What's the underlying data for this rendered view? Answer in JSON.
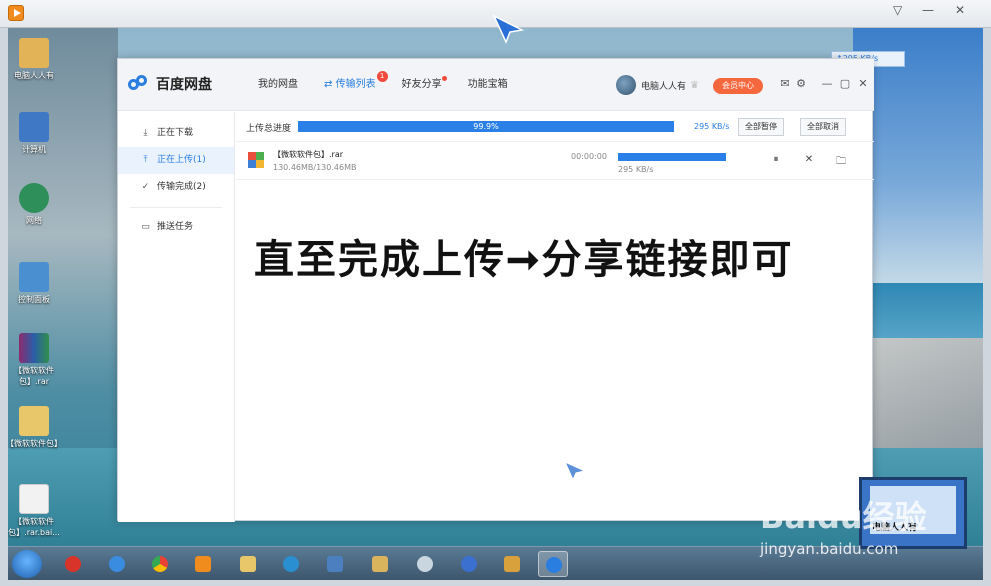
{
  "desktop": {
    "icons": [
      {
        "label": "电脑人人有"
      },
      {
        "label": "计算机"
      },
      {
        "label": "网络"
      },
      {
        "label": "控制面板"
      },
      {
        "label": "【微软软件包】.rar"
      },
      {
        "label": "【微软软件包】"
      },
      {
        "label": "【微软软件包】.rar.bai..."
      }
    ]
  },
  "float_speed": "↑295 KB/s",
  "app": {
    "title": "百度网盘",
    "nav": [
      {
        "label": "我的网盘"
      },
      {
        "label": "传输列表",
        "badge": "1"
      },
      {
        "label": "好友分享"
      },
      {
        "label": "功能宝箱"
      }
    ],
    "user": {
      "name": "电脑人人有",
      "vip_label": "会员中心"
    },
    "sidebar": [
      {
        "label": "正在下载"
      },
      {
        "label": "正在上传(1)"
      },
      {
        "label": "传输完成(2)"
      },
      {
        "label": "推送任务"
      }
    ],
    "upload": {
      "progress_label": "上传总进度",
      "total_percent": "99.9%",
      "speed": "295 KB/s",
      "pause_all": "全部暂停",
      "cancel_all": "全部取消",
      "file": {
        "name": "【微软软件包】.rar",
        "size": "130.46MB/130.46MB",
        "time": "00:00:00",
        "speed": "295 KB/s",
        "progress": 0.999
      }
    },
    "caption": "直至完成上传➞分享链接即可"
  },
  "watermark": {
    "logo": "Baidu经验",
    "url": "jingyan.baidu.com",
    "thumb_label": "电脑人人有"
  },
  "colors": {
    "accent": "#2a7ee0",
    "vip": "#f5673d",
    "badge": "#f04b3c"
  }
}
